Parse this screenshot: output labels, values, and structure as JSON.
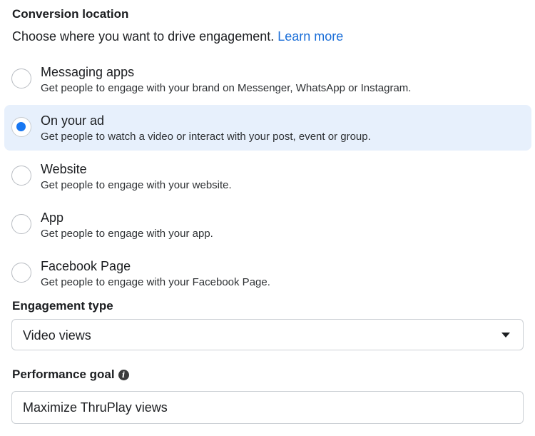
{
  "conversion_location": {
    "title": "Conversion location",
    "subtitle": "Choose where you want to drive engagement.",
    "learn_more": "Learn more",
    "options": [
      {
        "label": "Messaging apps",
        "description": "Get people to engage with your brand on Messenger, WhatsApp or Instagram.",
        "selected": false
      },
      {
        "label": "On your ad",
        "description": "Get people to watch a video or interact with your post, event or group.",
        "selected": true
      },
      {
        "label": "Website",
        "description": "Get people to engage with your website.",
        "selected": false
      },
      {
        "label": "App",
        "description": "Get people to engage with your app.",
        "selected": false
      },
      {
        "label": "Facebook Page",
        "description": "Get people to engage with your Facebook Page.",
        "selected": false
      }
    ]
  },
  "engagement_type": {
    "title": "Engagement type",
    "value": "Video views",
    "icon": "caret-down-icon"
  },
  "performance_goal": {
    "title": "Performance goal",
    "info_icon": "info-icon",
    "value": "Maximize ThruPlay views"
  },
  "colors": {
    "accent": "#1877f2",
    "link": "#1a6ed8",
    "selected_bg": "#e7f0fc"
  }
}
